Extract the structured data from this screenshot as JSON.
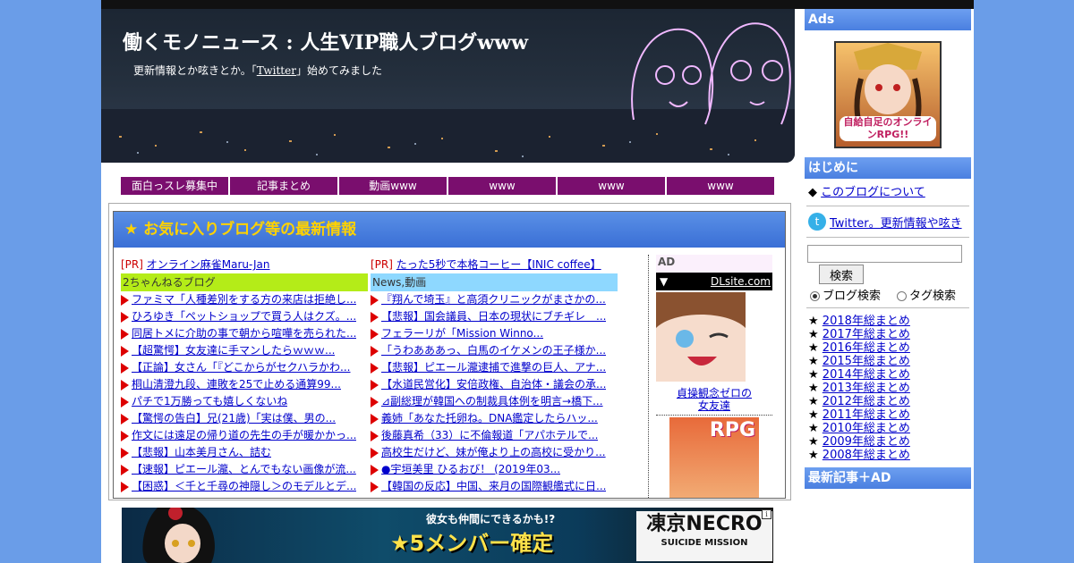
{
  "header": {
    "title": "働くモノニュース : 人生VIP職人ブログwww",
    "desc_prefix": "更新情報とか呟きとか。「",
    "desc_link": "Twitter",
    "desc_suffix": "」始めてみました"
  },
  "nav": [
    "面白っスレ募集中",
    "記事まとめ",
    "動画www",
    "www",
    "www",
    "www"
  ],
  "main": {
    "box_title": "★ お気に入りブログ等の最新情報",
    "col1": {
      "pr_tag": "[PR]",
      "pr_link": "オンライン麻雀Maru-Jan",
      "head": "2ちゃんねるブログ",
      "items": [
        "ファミマ「人種差別をする方の来店は拒絶し...",
        "ひろゆき「ペットショップで買う人はクズ。...",
        "同居トメに介助の事で朝から喧嘩を売られた...",
        "【超驚愕】女友達に手マンしたらｗｗｗ...",
        "【正論】女さん「『どこからがセクハラかわ...",
        "桐山清澄九段、連敗を25で止める通算99...",
        "パチで1万勝っても嬉しくないね",
        "【驚愕の告白】兄(21歳)「実は僕、男の...",
        "作文には遠足の帰り道の先生の手が暖かかっ...",
        "【悲報】山本美月さん、詰む",
        "【速報】ピエール瀧、とんでもない画像が流...",
        "【困惑】＜千と千尋の神隠し＞のモデルとデ..."
      ]
    },
    "col2": {
      "pr_tag": "[PR]",
      "pr_link": "たった5秒で本格コーヒー【INIC coffee】",
      "head": "News,動画",
      "items": [
        "『翔んで埼玉』と高須クリニックがまさかの...",
        "【悲報】国会議員、日本の現状にブチギレ　...",
        "フェラーリが「Mission Winno...",
        "「うわあああっ、白馬のイケメンの王子様か...",
        "【悲報】ピエール瀧逮捕で進撃の巨人、アナ...",
        "【水道民営化】安倍政権、自治体・議会の承...",
        "⊿副総理が韓国への制裁具体例を明言→橋下...",
        "義姉「あなた托卵ね。DNA鑑定したらハッ...",
        "後藤真希（33）に不倫報道「アパホテルで...",
        "高校生だけど、妹が俺より上の高校に受かり...",
        "●宇垣美里 ひるおび！ (2019年03...",
        "【韓国の反応】中国、来月の国際観艦式に日..."
      ]
    },
    "ad_label": "AD",
    "dl_arrow": "▼",
    "dl_link": "DLsite.com",
    "ad1_caption_1": "貞操観念ゼロの",
    "ad1_caption_2": "女友達",
    "ad2_badge": "RPG"
  },
  "banner": {
    "tagline": "彼女も仲間にできるかも!?",
    "headline": "★5メンバー確定",
    "brand": "凍京NECRO",
    "brand_sub": "SUICIDE MISSION",
    "info": "i"
  },
  "sidebar": {
    "ads_head": "Ads",
    "ad_text": "自給自足のオンラインRPG!!",
    "intro_head": "はじめに",
    "intro_bullet": "◆",
    "intro_link": "このブログについて",
    "twitter_icon": "t",
    "twitter_link": "Twitter。更新情報や呟き",
    "search_button": "検索",
    "radio_blog": "ブログ検索",
    "radio_tag": "タグ検索",
    "star": "★",
    "years": [
      "2018年総まとめ",
      "2017年総まとめ",
      "2016年総まとめ",
      "2015年総まとめ",
      "2014年総まとめ",
      "2013年総まとめ",
      "2012年総まとめ",
      "2011年総まとめ",
      "2010年総まとめ",
      "2009年総まとめ",
      "2008年総まとめ"
    ],
    "recent_head": "最新記事＋AD"
  }
}
